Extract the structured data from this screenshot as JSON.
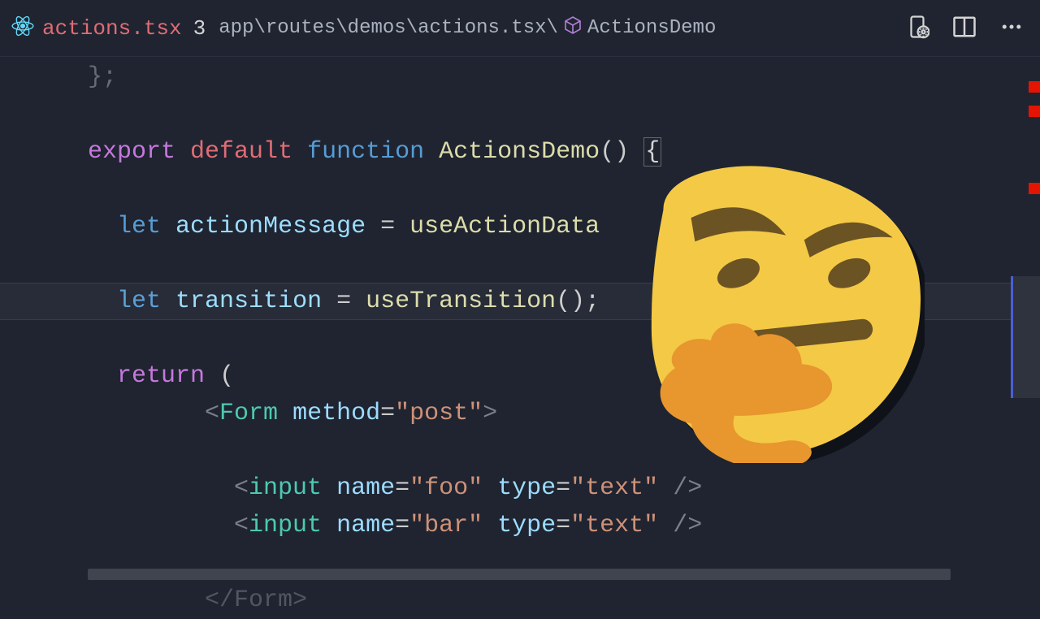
{
  "tab": {
    "filename": "actions.tsx",
    "modified_indicator": "3"
  },
  "breadcrumbs": {
    "path": "app\\routes\\demos\\actions.tsx\\",
    "symbol": "ActionsDemo"
  },
  "code": {
    "remnant_top": "};",
    "line_export": {
      "export": "export",
      "default": "default",
      "function": "function",
      "name": "ActionsDemo",
      "parens": "()",
      "brace": "{"
    },
    "line_action": {
      "let": "let",
      "var": "actionMessage",
      "eq": "=",
      "call": "useActionData"
    },
    "line_transition": {
      "let": "let",
      "var": "transition",
      "eq": "=",
      "call": "useTransition",
      "parens": "();"
    },
    "line_return": {
      "return": "return",
      "paren": "("
    },
    "line_form_open": {
      "angle_open": "<",
      "tag": "Form",
      "attr": "method",
      "eq": "=",
      "val": "\"post\"",
      "angle_close": ">"
    },
    "line_input1": {
      "angle_open": "<",
      "tag": "input",
      "attr1": "name",
      "val1": "\"foo\"",
      "attr2": "type",
      "val2": "\"text\"",
      "close": "/>"
    },
    "line_input2": {
      "angle_open": "<",
      "tag": "input",
      "attr1": "name",
      "val1": "\"bar\"",
      "attr2": "type",
      "val2": "\"text\"",
      "close": "/>"
    },
    "line_form_close": {
      "text": "</Form>"
    }
  },
  "minimap": {
    "error_marker_positions": [
      30,
      60,
      155
    ]
  }
}
